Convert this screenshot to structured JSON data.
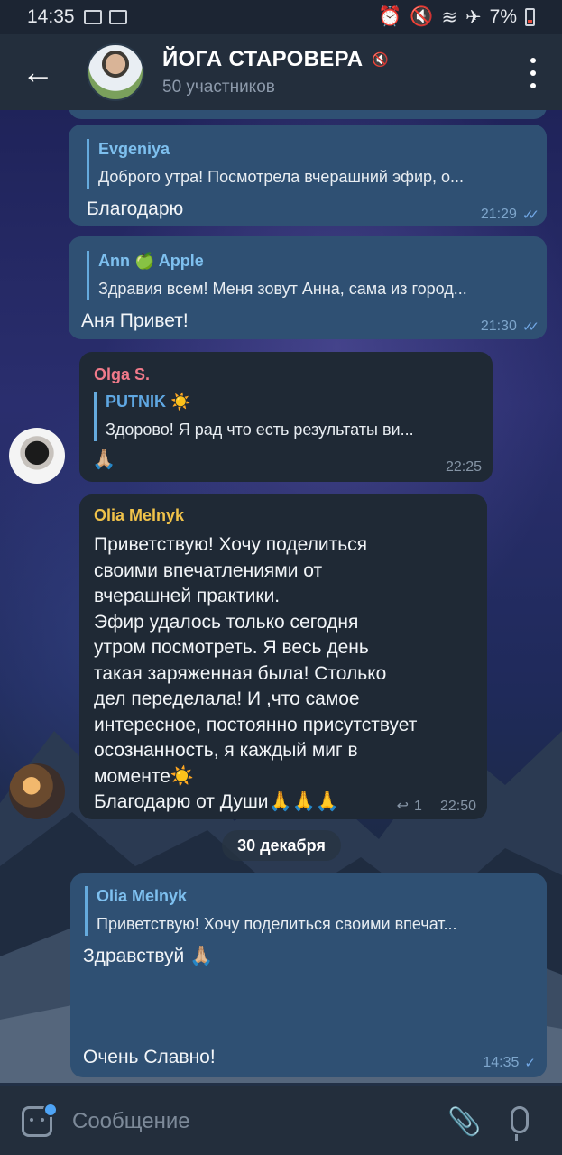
{
  "status_bar": {
    "time": "14:35",
    "battery": "7%"
  },
  "header": {
    "title": "ЙОГА СТАРОВЕРА",
    "subtitle": "50 участников",
    "back_icon": "arrow-left-icon",
    "menu_icon": "more-vertical-icon"
  },
  "messages": [
    {
      "id": "m1",
      "type": "out",
      "reply_to": {
        "name": "Evgeniya",
        "text": "Доброго утра! Посмотрела вчерашний эфир, о..."
      },
      "text": "Благодарю",
      "time": "21:29"
    },
    {
      "id": "m2",
      "type": "out",
      "reply_to": {
        "name": "Ann 🍏 Apple",
        "text": "Здравия всем! Меня зовут Анна, сама из город..."
      },
      "text": "Аня Привет!",
      "time": "21:30"
    },
    {
      "id": "m3",
      "type": "in",
      "sender": "Olga S.",
      "reply_to": {
        "name": "PUTNIK ☀️",
        "text": "Здорово!  Я рад что есть результаты ви..."
      },
      "text": "🙏🏼",
      "time": "22:25"
    },
    {
      "id": "m4",
      "type": "in",
      "sender": "Olia Melnyk",
      "lines": [
        "Приветствую! Хочу поделиться",
        "своими впечатлениями от",
        "вчерашней практики.",
        "Эфир удалось только сегодня",
        "утром посмотреть. Я весь день",
        "такая заряженная была! Столько",
        "дел переделала! И ,что самое",
        "интересное, постоянно присутствует",
        "осознанность, я каждый миг в",
        "моменте☀️",
        "Благодарю от Души🙏🙏🙏"
      ],
      "reply_count": "1",
      "time": "22:50"
    },
    {
      "id": "m5",
      "type": "out",
      "reply_to": {
        "name": "Olia Melnyk",
        "text": "Приветствую! Хочу поделиться своими впечат..."
      },
      "text": "Здравствуй 🙏🏼",
      "text2": "Очень Славно!",
      "time": "14:35"
    }
  ],
  "date_separator": "30 декабря",
  "input": {
    "placeholder": "Сообщение"
  },
  "colors": {
    "outgoing_bubble": "#2f5073",
    "incoming_bubble": "#1f2935",
    "accent": "#4ea4f6",
    "olga_name": "#f07a8a",
    "olia_name": "#f0c24a"
  }
}
